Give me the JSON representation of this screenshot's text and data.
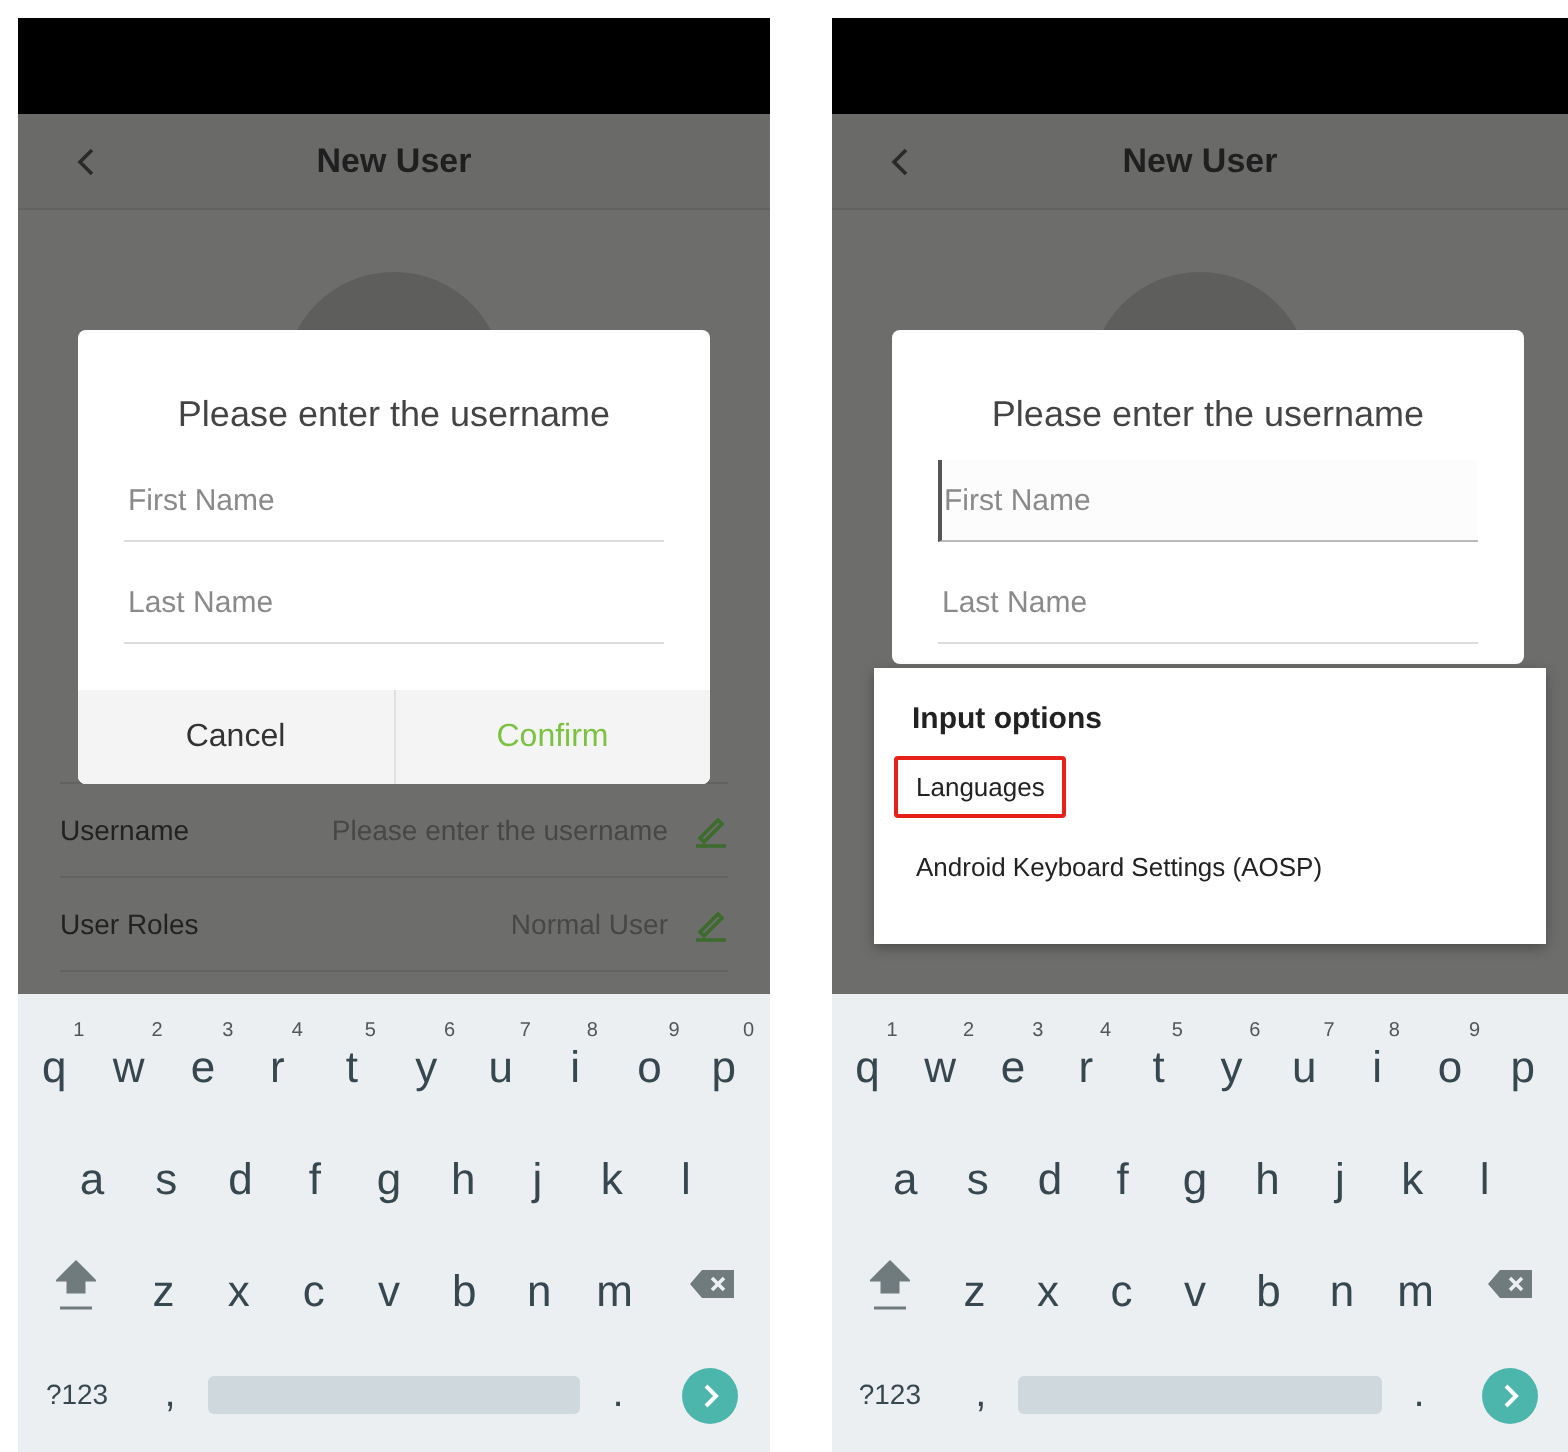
{
  "screens": [
    {
      "header": {
        "title": "New User"
      },
      "rows": [
        {
          "label": "Username",
          "value": "Please enter the username"
        },
        {
          "label": "User Roles",
          "value": "Normal User"
        }
      ],
      "dialog": {
        "title": "Please enter the username",
        "fields": [
          {
            "placeholder": "First Name",
            "focused": false
          },
          {
            "placeholder": "Last Name",
            "focused": false
          }
        ],
        "buttons": [
          {
            "label": "Cancel",
            "kind": "cancel"
          },
          {
            "label": "Confirm",
            "kind": "confirm"
          }
        ]
      },
      "keyboard": {
        "key_rows": [
          {
            "keys": [
              {
                "kind": "letter",
                "label": "q",
                "hint": "1"
              },
              {
                "kind": "letter",
                "label": "w",
                "hint": "2"
              },
              {
                "kind": "letter",
                "label": "e",
                "hint": "3"
              },
              {
                "kind": "letter",
                "label": "r",
                "hint": "4"
              },
              {
                "kind": "letter",
                "label": "t",
                "hint": "5"
              },
              {
                "kind": "letter",
                "label": "y",
                "hint": "6"
              },
              {
                "kind": "letter",
                "label": "u",
                "hint": "7"
              },
              {
                "kind": "letter",
                "label": "i",
                "hint": "8"
              },
              {
                "kind": "letter",
                "label": "o",
                "hint": "9"
              },
              {
                "kind": "letter",
                "label": "p",
                "hint": "0"
              }
            ]
          },
          {
            "keys": [
              {
                "kind": "letter",
                "label": "a"
              },
              {
                "kind": "letter",
                "label": "s"
              },
              {
                "kind": "letter",
                "label": "d"
              },
              {
                "kind": "letter",
                "label": "f"
              },
              {
                "kind": "letter",
                "label": "g"
              },
              {
                "kind": "letter",
                "label": "h"
              },
              {
                "kind": "letter",
                "label": "j"
              },
              {
                "kind": "letter",
                "label": "k"
              },
              {
                "kind": "letter",
                "label": "l"
              }
            ]
          },
          {
            "keys": [
              {
                "kind": "shift"
              },
              {
                "kind": "letter",
                "label": "z"
              },
              {
                "kind": "letter",
                "label": "x"
              },
              {
                "kind": "letter",
                "label": "c"
              },
              {
                "kind": "letter",
                "label": "v"
              },
              {
                "kind": "letter",
                "label": "b"
              },
              {
                "kind": "letter",
                "label": "n"
              },
              {
                "kind": "letter",
                "label": "m"
              },
              {
                "kind": "backspace"
              }
            ]
          },
          {
            "keys": [
              {
                "kind": "symbols",
                "label": "?123"
              },
              {
                "kind": "punct",
                "label": ","
              },
              {
                "kind": "space"
              },
              {
                "kind": "punct",
                "label": "."
              },
              {
                "kind": "enter"
              }
            ]
          }
        ]
      }
    },
    {
      "header": {
        "title": "New User"
      },
      "dialog": {
        "title": "Please enter the username",
        "fields": [
          {
            "placeholder": "First Name",
            "focused": true
          },
          {
            "placeholder": "Last Name",
            "focused": false
          }
        ]
      },
      "popup": {
        "title": "Input options",
        "items": [
          {
            "label": "Languages",
            "highlighted": true
          },
          {
            "label": "Android Keyboard Settings (AOSP)",
            "highlighted": false
          }
        ]
      },
      "keyboard": {
        "key_rows": [
          {
            "keys": [
              {
                "kind": "letter",
                "label": "q",
                "hint": "1"
              },
              {
                "kind": "letter",
                "label": "w",
                "hint": "2"
              },
              {
                "kind": "letter",
                "label": "e",
                "hint": "3"
              },
              {
                "kind": "letter",
                "label": "r",
                "hint": "4"
              },
              {
                "kind": "letter",
                "label": "t",
                "hint": "5"
              },
              {
                "kind": "letter",
                "label": "y",
                "hint": "6"
              },
              {
                "kind": "letter",
                "label": "u",
                "hint": "7"
              },
              {
                "kind": "letter",
                "label": "i",
                "hint": "8"
              },
              {
                "kind": "letter",
                "label": "o",
                "hint": "9"
              },
              {
                "kind": "letter",
                "label": "p"
              }
            ]
          },
          {
            "keys": [
              {
                "kind": "letter",
                "label": "a"
              },
              {
                "kind": "letter",
                "label": "s"
              },
              {
                "kind": "letter",
                "label": "d"
              },
              {
                "kind": "letter",
                "label": "f"
              },
              {
                "kind": "letter",
                "label": "g"
              },
              {
                "kind": "letter",
                "label": "h"
              },
              {
                "kind": "letter",
                "label": "j"
              },
              {
                "kind": "letter",
                "label": "k"
              },
              {
                "kind": "letter",
                "label": "l"
              }
            ]
          },
          {
            "keys": [
              {
                "kind": "shift"
              },
              {
                "kind": "letter",
                "label": "z"
              },
              {
                "kind": "letter",
                "label": "x"
              },
              {
                "kind": "letter",
                "label": "c"
              },
              {
                "kind": "letter",
                "label": "v"
              },
              {
                "kind": "letter",
                "label": "b"
              },
              {
                "kind": "letter",
                "label": "n"
              },
              {
                "kind": "letter",
                "label": "m"
              },
              {
                "kind": "backspace"
              }
            ]
          },
          {
            "keys": [
              {
                "kind": "symbols",
                "label": "?123"
              },
              {
                "kind": "punct",
                "label": ","
              },
              {
                "kind": "space"
              },
              {
                "kind": "punct",
                "label": "."
              },
              {
                "kind": "enter"
              }
            ]
          }
        ]
      }
    }
  ]
}
